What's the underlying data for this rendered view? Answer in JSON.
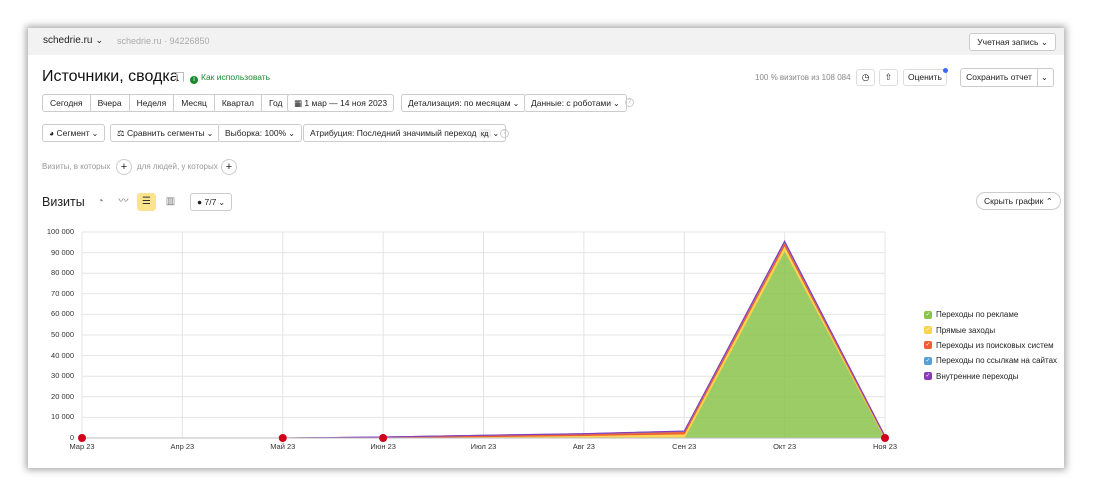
{
  "header": {
    "site": "schedrie.ru",
    "site_sub": "schedrie.ru · 94226850",
    "account": "Учетная запись"
  },
  "report": {
    "title": "Источники, сводка",
    "howto": "Как использовать",
    "visits_info": "100 % визитов из 108 084",
    "rate": "Оценить",
    "save": "Сохранить отчет"
  },
  "periods": [
    "Сегодня",
    "Вчера",
    "Неделя",
    "Месяц",
    "Квартал",
    "Год"
  ],
  "controls": {
    "date_range": "1 мар — 14 ноя 2023",
    "detail": "Детализация: по месяцам",
    "data": "Данные: с роботами",
    "segment": "Сегмент",
    "compare": "Сравнить сегменты",
    "sample": "Выборка: 100%",
    "attribution": "Атрибуция: Последний значимый переход",
    "attribution_badge": "кд"
  },
  "filters": {
    "visits_label": "Визиты, в которых",
    "people_label": "для людей, у которых"
  },
  "chart_panel": {
    "title": "Визиты",
    "metrics_count": "7/7",
    "hide": "Скрыть график"
  },
  "colors": {
    "ads": "#8bc34a",
    "direct": "#fbd34d",
    "search": "#ef5d33",
    "links": "#55a0d6",
    "internal": "#8a3ab9",
    "event_marker": "#d0021b",
    "active_tool": "#fce48e"
  },
  "chart_data": {
    "type": "area",
    "stacked": true,
    "x": [
      "Мар 23",
      "Апр 23",
      "Май 23",
      "Июн 23",
      "Июл 23",
      "Авг 23",
      "Сен 23",
      "Окт 23",
      "Ноя 23"
    ],
    "ylim": [
      0,
      100000
    ],
    "yticks": [
      "100 000",
      "90 000",
      "80 000",
      "70 000",
      "60 000",
      "50 000",
      "40 000",
      "30 000",
      "20 000",
      "10 000",
      "0"
    ],
    "series": [
      {
        "name": "Переходы по рекламе",
        "color": "#8bc34a",
        "values": [
          0,
          0,
          0,
          0,
          0,
          0,
          0,
          91000,
          0
        ]
      },
      {
        "name": "Прямые заходы",
        "color": "#fbd34d",
        "values": [
          0,
          0,
          0,
          200,
          700,
          1200,
          2000,
          2500,
          400
        ]
      },
      {
        "name": "Переходы из поисковых систем",
        "color": "#ef5d33",
        "values": [
          0,
          0,
          0,
          300,
          600,
          800,
          1200,
          1500,
          400
        ]
      },
      {
        "name": "Переходы по ссылкам на сайтах",
        "color": "#55a0d6",
        "values": [
          0,
          0,
          0,
          0,
          50,
          100,
          150,
          400,
          50
        ]
      },
      {
        "name": "Внутренние переходы",
        "color": "#8a3ab9",
        "values": [
          0,
          0,
          0,
          0,
          0,
          50,
          50,
          200,
          0
        ]
      }
    ],
    "grid": true,
    "legend_position": "right",
    "event_markers": [
      "Мар 23",
      "Май 23",
      "Июн 23",
      "Ноя 23"
    ]
  }
}
